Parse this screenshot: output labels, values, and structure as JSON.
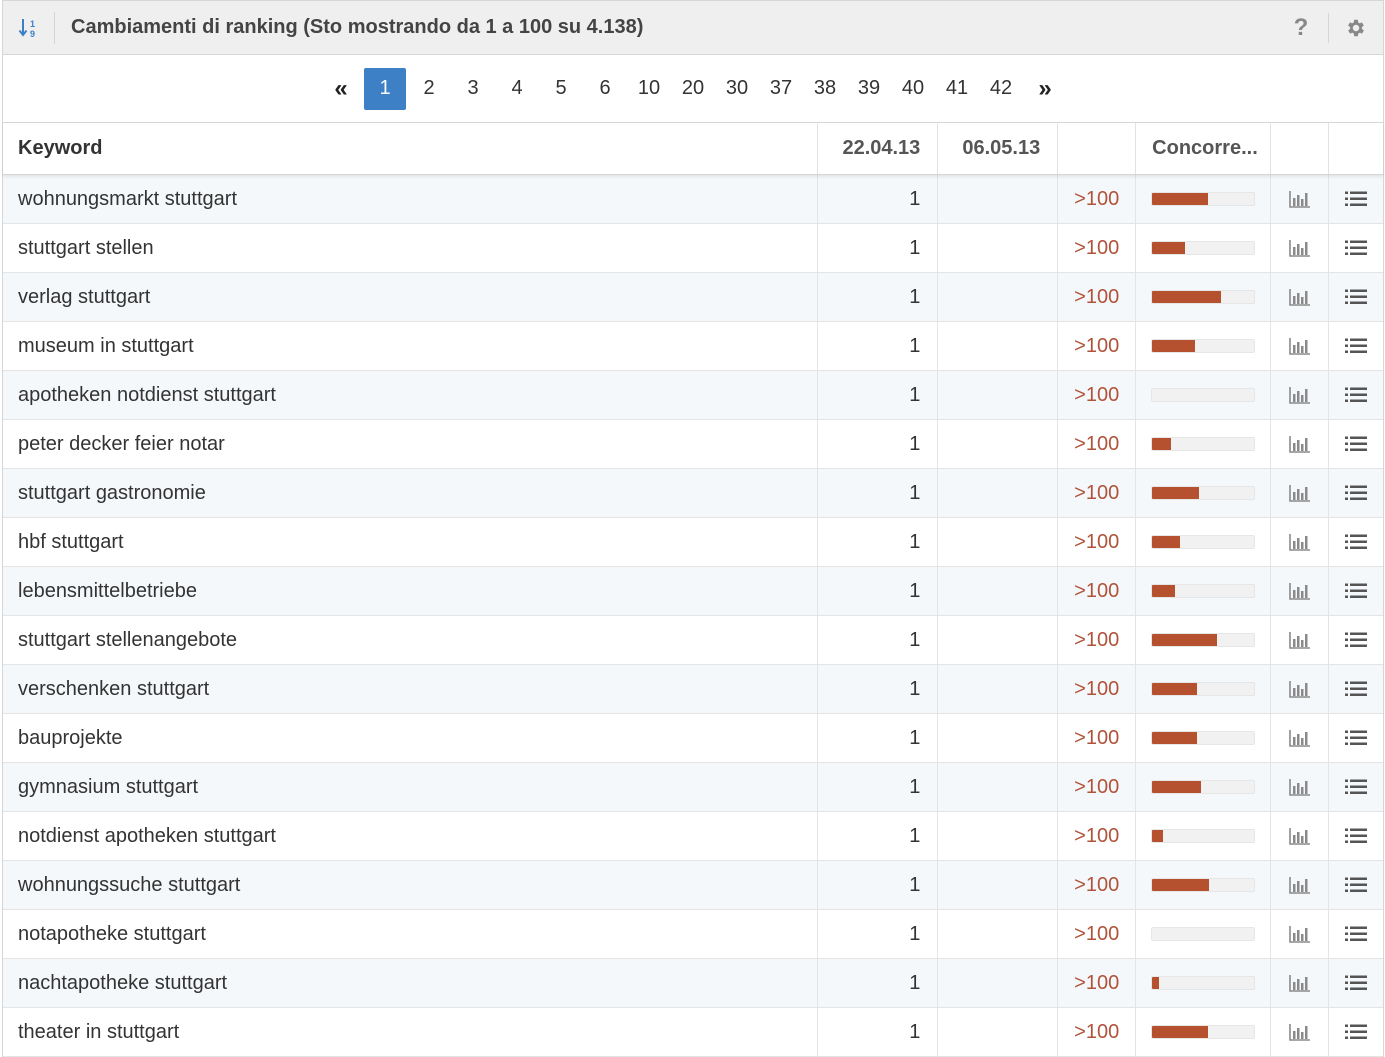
{
  "header": {
    "title": "Cambiamenti di ranking (Sto mostrando da 1 a 100 su 4.138)",
    "help_label": "?"
  },
  "pagination": {
    "prev_label": "«",
    "next_label": "»",
    "pages": [
      "1",
      "2",
      "3",
      "4",
      "5",
      "6",
      "10",
      "20",
      "30",
      "37",
      "38",
      "39",
      "40",
      "41",
      "42"
    ],
    "active": "1"
  },
  "table": {
    "columns": {
      "keyword": "Keyword",
      "date1": "22.04.13",
      "date2": "06.05.13",
      "change": "",
      "competition": "Concorre..."
    },
    "rows": [
      {
        "keyword": "wohnungsmarkt stuttgart",
        "date1": "1",
        "date2": "",
        "change": ">100",
        "competition": 0.55
      },
      {
        "keyword": "stuttgart stellen",
        "date1": "1",
        "date2": "",
        "change": ">100",
        "competition": 0.32
      },
      {
        "keyword": "verlag stuttgart",
        "date1": "1",
        "date2": "",
        "change": ">100",
        "competition": 0.67
      },
      {
        "keyword": "museum in stuttgart",
        "date1": "1",
        "date2": "",
        "change": ">100",
        "competition": 0.42
      },
      {
        "keyword": "apotheken notdienst stuttgart",
        "date1": "1",
        "date2": "",
        "change": ">100",
        "competition": 0.0
      },
      {
        "keyword": "peter decker feier notar",
        "date1": "1",
        "date2": "",
        "change": ">100",
        "competition": 0.18
      },
      {
        "keyword": "stuttgart gastronomie",
        "date1": "1",
        "date2": "",
        "change": ">100",
        "competition": 0.46
      },
      {
        "keyword": "hbf stuttgart",
        "date1": "1",
        "date2": "",
        "change": ">100",
        "competition": 0.27
      },
      {
        "keyword": "lebensmittelbetriebe",
        "date1": "1",
        "date2": "",
        "change": ">100",
        "competition": 0.22
      },
      {
        "keyword": "stuttgart stellenangebote",
        "date1": "1",
        "date2": "",
        "change": ">100",
        "competition": 0.64
      },
      {
        "keyword": "verschenken stuttgart",
        "date1": "1",
        "date2": "",
        "change": ">100",
        "competition": 0.44
      },
      {
        "keyword": "bauprojekte",
        "date1": "1",
        "date2": "",
        "change": ">100",
        "competition": 0.44
      },
      {
        "keyword": "gymnasium stuttgart",
        "date1": "1",
        "date2": "",
        "change": ">100",
        "competition": 0.48
      },
      {
        "keyword": "notdienst apotheken stuttgart",
        "date1": "1",
        "date2": "",
        "change": ">100",
        "competition": 0.11
      },
      {
        "keyword": "wohnungssuche stuttgart",
        "date1": "1",
        "date2": "",
        "change": ">100",
        "competition": 0.56
      },
      {
        "keyword": "notapotheke stuttgart",
        "date1": "1",
        "date2": "",
        "change": ">100",
        "competition": 0.0
      },
      {
        "keyword": "nachtapotheke stuttgart",
        "date1": "1",
        "date2": "",
        "change": ">100",
        "competition": 0.07
      },
      {
        "keyword": "theater in stuttgart",
        "date1": "1",
        "date2": "",
        "change": ">100",
        "competition": 0.55
      }
    ]
  },
  "colors": {
    "accent": "#3e80c6",
    "bar": "#b5512f",
    "change_text": "#b0533a"
  },
  "icons": {
    "sort": "sort-numeric-icon",
    "help": "help-icon",
    "settings": "gear-icon",
    "chart": "bar-chart-icon",
    "list": "list-icon"
  }
}
